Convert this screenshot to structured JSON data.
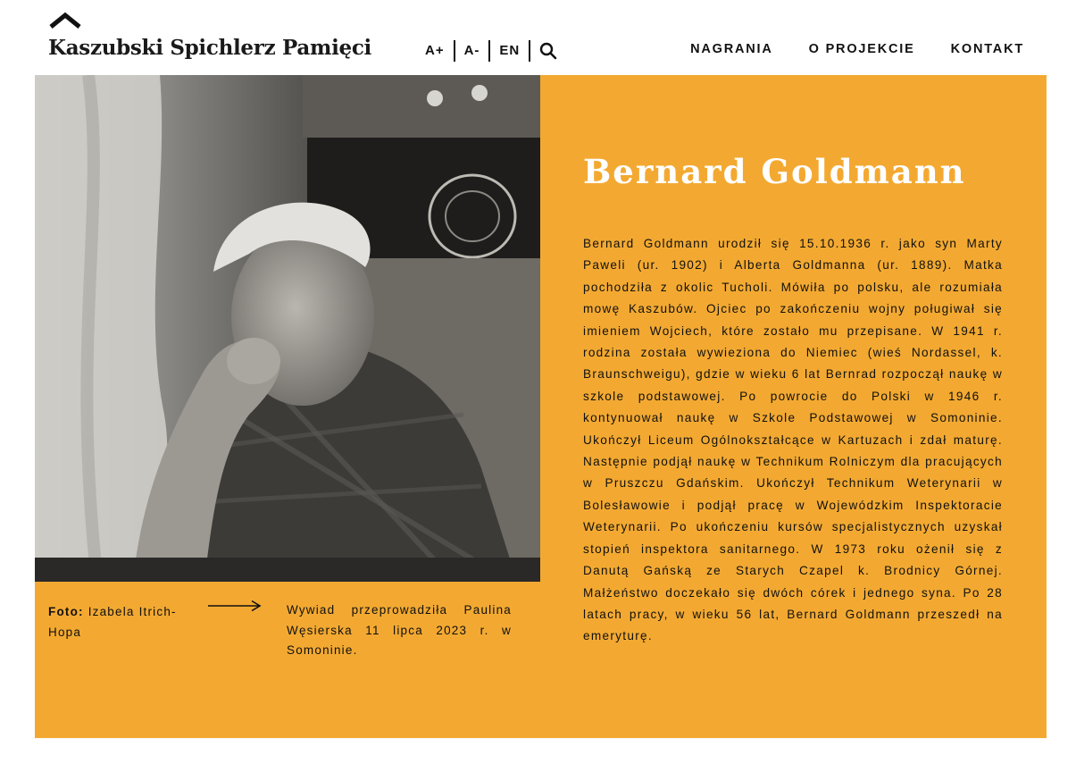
{
  "header": {
    "site_title": "Kaszubski Spichlerz Pamięci",
    "logo_icon": "roof-chevron-icon",
    "tools": {
      "font_increase": "A+",
      "font_decrease": "A-",
      "language": "EN",
      "search_icon": "search-icon"
    },
    "nav": [
      {
        "label": "NAGRANIA"
      },
      {
        "label": "O PROJEKCIE"
      },
      {
        "label": "KONTAKT"
      }
    ]
  },
  "colors": {
    "accent": "#f3a931",
    "title_on_accent": "#ffffff",
    "text": "#111111"
  },
  "photo": {
    "caption_label": "Foto:",
    "caption_author": "Izabela Itrich-Hopa",
    "arrow_icon": "long-arrow-right-icon"
  },
  "interview_note": "Wywiad przeprowadziła Paulina Węsierska 11 lipca 2023 r. w Somoninie.",
  "person": {
    "name": "Bernard Goldmann",
    "bio": "Bernard Goldmann urodził się 15.10.1936 r. jako syn Marty Paweli (ur. 1902) i Alberta Goldmanna (ur. 1889). Matka pochodziła z okolic Tucholi. Mówiła po polsku, ale rozumiała mowę Kaszubów. Ojciec po zakończeniu wojny poługiwał się imieniem Wojciech, które zostało mu przepisane. W 1941 r. rodzina została wywieziona do Niemiec (wieś Nordassel, k. Braunschweigu), gdzie w wieku 6 lat Bernrad rozpoczął naukę w szkole podstawowej. Po powrocie do Polski w 1946 r. kontynuował naukę w Szkole Podstawowej w Somoninie. Ukończył Liceum Ogólnokształcące w Kartuzach i zdał maturę. Następnie podjął naukę w Technikum Rolniczym dla pracujących w Pruszczu Gdańskim. Ukończył Technikum Weterynarii w Bolesławowie i podjął pracę w Wojewódzkim Inspektoracie Weterynarii. Po ukończeniu kursów specjalistycznych uzyskał stopień inspektora sanitarnego. W 1973 roku ożenił się z Danutą Gańską ze Starych Czapel k. Brodnicy Górnej. Małżeństwo doczekało się dwóch córek i jednego syna. Po 28 latach pracy, w wieku 56 lat, Bernard Goldmann przeszedł na emeryturę."
  }
}
